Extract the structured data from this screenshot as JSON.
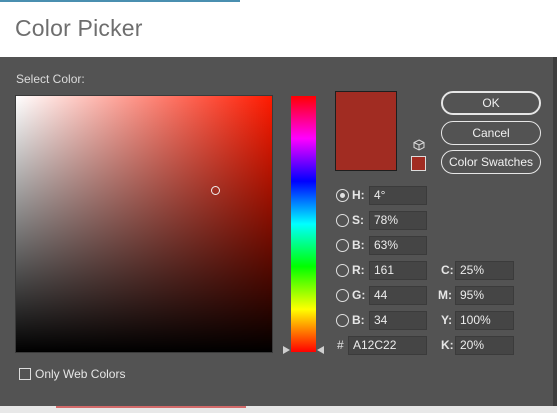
{
  "window": {
    "title": "Color Picker"
  },
  "picker": {
    "select_label": "Select Color:",
    "field_cursor": {
      "saturation": 0.78,
      "brightness": 0.63
    },
    "hue_degrees": 4
  },
  "swatch": {
    "new_color": "#A12C22",
    "small_color": "#A12C22"
  },
  "buttons": {
    "ok": "OK",
    "cancel": "Cancel",
    "color_swatches": "Color Swatches"
  },
  "hsb": {
    "h_label": "H:",
    "h_value": "4°",
    "s_label": "S:",
    "s_value": "78%",
    "b_label": "B:",
    "b_value": "63%",
    "selected": "H"
  },
  "rgb": {
    "r_label": "R:",
    "r_value": "161",
    "g_label": "G:",
    "g_value": "44",
    "b_label": "B:",
    "b_value": "34"
  },
  "hex": {
    "label": "#",
    "value": "A12C22"
  },
  "cmyk": {
    "c_label": "C:",
    "c_value": "25%",
    "m_label": "M:",
    "m_value": "95%",
    "y_label": "Y:",
    "y_value": "100%",
    "k_label": "K:",
    "k_value": "20%"
  },
  "options": {
    "only_web_colors": "Only Web Colors",
    "only_web_colors_checked": false
  },
  "icons": {
    "gamut": "cube-icon"
  }
}
